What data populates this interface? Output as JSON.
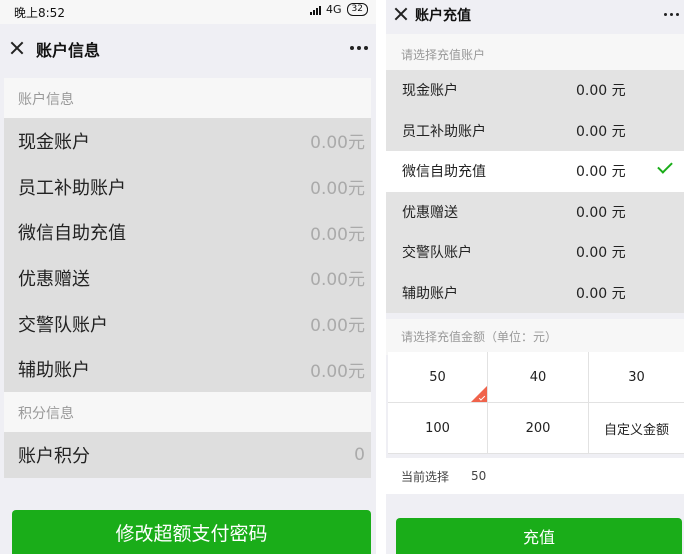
{
  "left_screen": {
    "status_bar": {
      "time": "晚上8:52",
      "network": "4G",
      "battery": "32"
    },
    "nav": {
      "title": "账户信息"
    },
    "accounts_header": "账户信息",
    "accounts": [
      {
        "label": "现金账户",
        "value": "0.00元"
      },
      {
        "label": "员工补助账户",
        "value": "0.00元"
      },
      {
        "label": "微信自助充值",
        "value": "0.00元"
      },
      {
        "label": "优惠赠送",
        "value": "0.00元"
      },
      {
        "label": "交警队账户",
        "value": "0.00元"
      },
      {
        "label": "辅助账户",
        "value": "0.00元"
      }
    ],
    "points_header": "积分信息",
    "points": [
      {
        "label": "账户积分",
        "value": "0"
      }
    ],
    "button_label": "修改超额支付密码"
  },
  "right_screen": {
    "nav": {
      "title": "账户充值"
    },
    "select_account_label": "请选择充值账户",
    "accounts": [
      {
        "label": "现金账户",
        "value": "0.00 元",
        "selected": false
      },
      {
        "label": "员工补助账户",
        "value": "0.00 元",
        "selected": false
      },
      {
        "label": "微信自助充值",
        "value": "0.00 元",
        "selected": true
      },
      {
        "label": "优惠赠送",
        "value": "0.00 元",
        "selected": false
      },
      {
        "label": "交警队账户",
        "value": "0.00 元",
        "selected": false
      },
      {
        "label": "辅助账户",
        "value": "0.00 元",
        "selected": false
      }
    ],
    "amount_label": "请选择充值金额（单位：元）",
    "amounts": [
      "50",
      "40",
      "30",
      "100",
      "200",
      "自定义金额"
    ],
    "selected_amount_index": 0,
    "current_selection_label": "当前选择",
    "current_selection_value": "50",
    "button_label": "充值"
  },
  "colors": {
    "accent": "#1aad19",
    "corner_badge": "#f0634b",
    "row_gray": "#dedede"
  }
}
